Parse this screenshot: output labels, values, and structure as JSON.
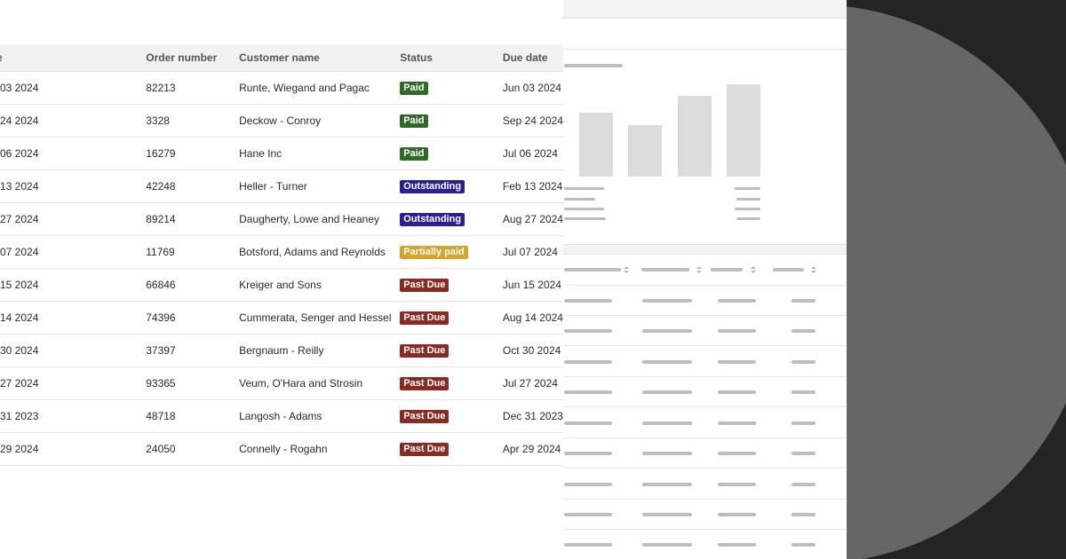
{
  "colors": {
    "paid": "#2f6b27",
    "outstanding": "#2c1f94",
    "partially_paid": "#d4a52a",
    "past_due": "#8a2b23"
  },
  "table": {
    "headers": {
      "date": "e",
      "order_number": "Order number",
      "customer_name": "Customer name",
      "status": "Status",
      "due_date": "Due date"
    },
    "rows": [
      {
        "date": "03 2024",
        "order": "82213",
        "customer": "Runte, Wiegand and Pagac",
        "status": "Paid",
        "status_kind": "paid",
        "due": "Jun 03 2024"
      },
      {
        "date": "24 2024",
        "order": "3328",
        "customer": "Deckow - Conroy",
        "status": "Paid",
        "status_kind": "paid",
        "due": "Sep 24 2024"
      },
      {
        "date": "06 2024",
        "order": "16279",
        "customer": "Hane Inc",
        "status": "Paid",
        "status_kind": "paid",
        "due": "Jul 06 2024"
      },
      {
        "date": "13 2024",
        "order": "42248",
        "customer": "Heller - Turner",
        "status": "Outstanding",
        "status_kind": "outstanding",
        "due": "Feb 13 2024"
      },
      {
        "date": "27 2024",
        "order": "89214",
        "customer": "Daugherty, Lowe and Heaney",
        "status": "Outstanding",
        "status_kind": "outstanding",
        "due": "Aug 27 2024"
      },
      {
        "date": "07 2024",
        "order": "11769",
        "customer": "Botsford, Adams and Reynolds",
        "status": "Partially paid",
        "status_kind": "partial",
        "due": "Jul 07 2024"
      },
      {
        "date": "15 2024",
        "order": "66846",
        "customer": "Kreiger and Sons",
        "status": "Past Due",
        "status_kind": "pastdue",
        "due": "Jun 15 2024"
      },
      {
        "date": "14 2024",
        "order": "74396",
        "customer": "Cummerata, Senger and Hessel",
        "status": "Past Due",
        "status_kind": "pastdue",
        "due": "Aug 14 2024"
      },
      {
        "date": "30 2024",
        "order": "37397",
        "customer": "Bergnaum - Reilly",
        "status": "Past Due",
        "status_kind": "pastdue",
        "due": "Oct 30 2024"
      },
      {
        "date": "27 2024",
        "order": "93365",
        "customer": "Veum, O'Hara and Strosin",
        "status": "Past Due",
        "status_kind": "pastdue",
        "due": "Jul 27 2024"
      },
      {
        "date": "31 2023",
        "order": "48718",
        "customer": "Langosh - Adams",
        "status": "Past Due",
        "status_kind": "pastdue",
        "due": "Dec 31 2023"
      },
      {
        "date": "29 2024",
        "order": "24050",
        "customer": "Connelly - Rogahn",
        "status": "Past Due",
        "status_kind": "pastdue",
        "due": "Apr 29 2024"
      }
    ]
  }
}
